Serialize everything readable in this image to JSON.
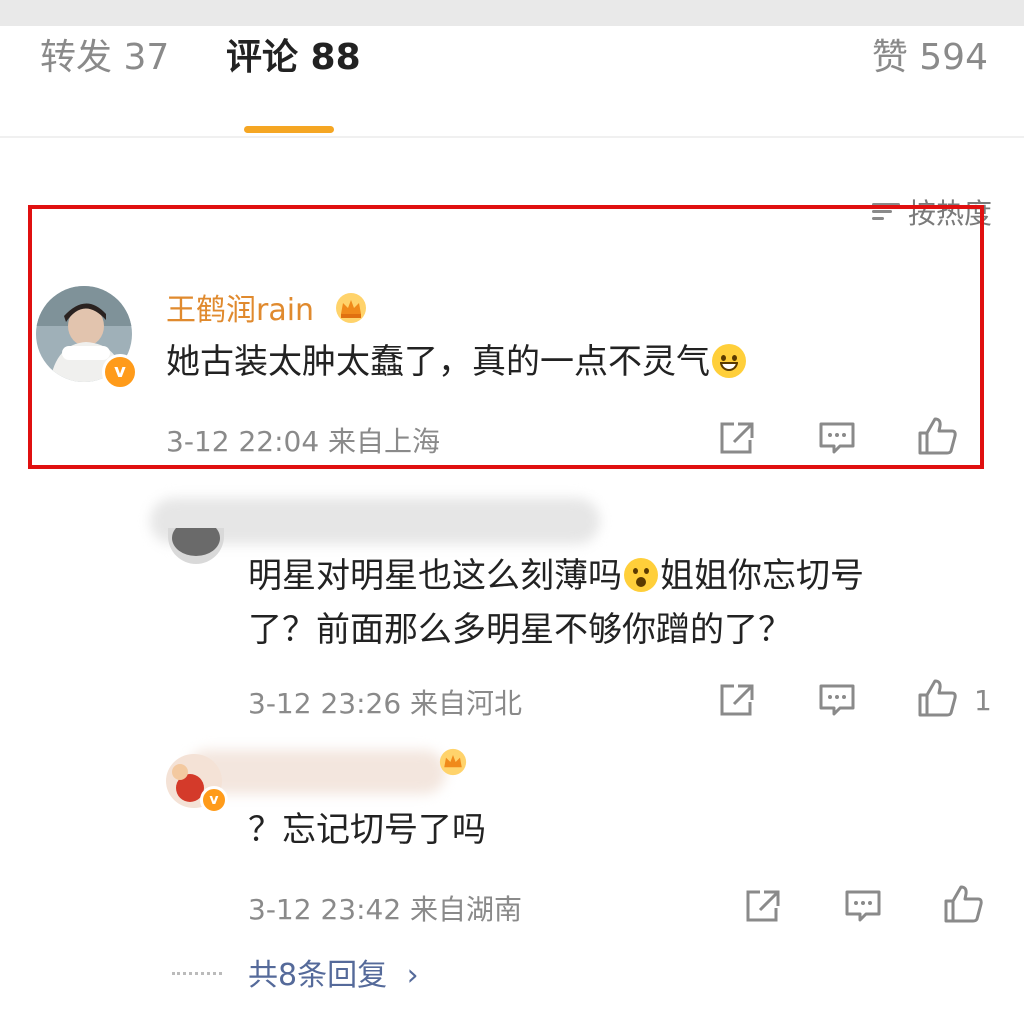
{
  "tabs": {
    "reposts": "转发 37",
    "comments": "评论 88",
    "likes": "赞 594"
  },
  "sort_label": "按热度",
  "comments": [
    {
      "username": "王鹤润rain",
      "text": "她古装太肿太蠢了，真的一点不灵气",
      "emoji": "laughing-emoji",
      "meta": "3-12 22:04 来自上海"
    },
    {
      "text_line1": "明星对明星也这么刻薄吗",
      "emoji": "shocked-emoji",
      "text_line1b": "姐姐你忘切号",
      "text_line2": "了？前面那么多明星不够你蹭的了？",
      "meta": "3-12 23:26 来自河北",
      "like_count": "1"
    },
    {
      "text": "？忘记切号了吗",
      "meta": "3-12 23:42 来自湖南"
    }
  ],
  "replies_link": "共8条回复",
  "colors": {
    "accent": "#f5a623",
    "username": "#e08a2e",
    "highlight": "#e01010",
    "verified": "#ff9b1a"
  }
}
